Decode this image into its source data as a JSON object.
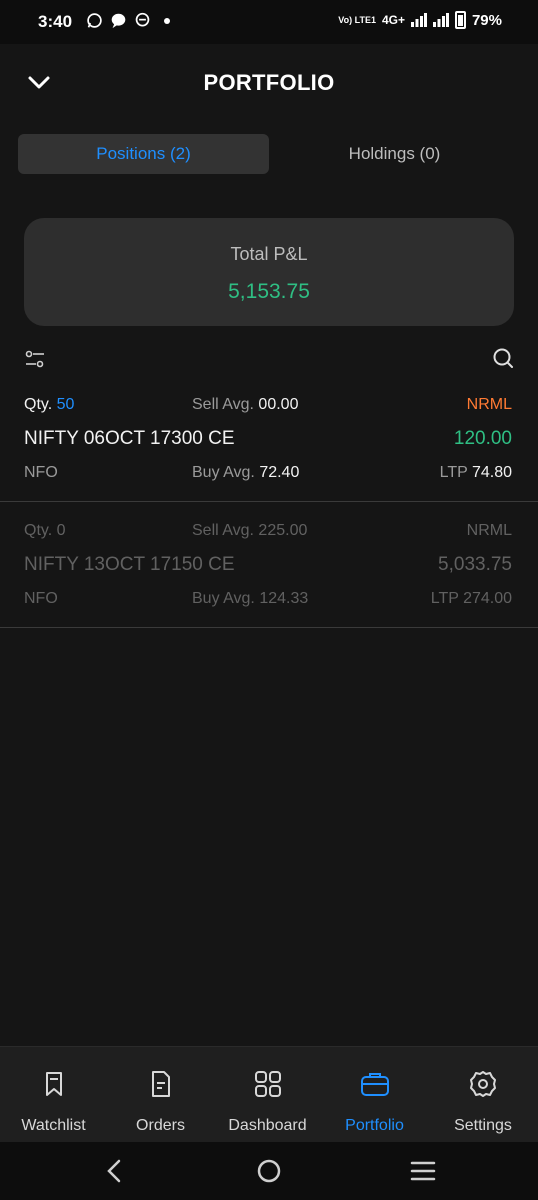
{
  "status_bar": {
    "time": "3:40",
    "network_small": "Vo) LTE1",
    "network": "4G+",
    "battery": "79%"
  },
  "header": {
    "title": "PORTFOLIO"
  },
  "tabs": [
    {
      "label": "Positions (2)",
      "active": true
    },
    {
      "label": "Holdings (0)",
      "active": false
    }
  ],
  "pnl": {
    "label": "Total P&L",
    "value": "5,153.75"
  },
  "positions": [
    {
      "qty_label": "Qty.",
      "qty": "50",
      "sell_avg_label": "Sell Avg.",
      "sell_avg": "00.00",
      "product": "NRML",
      "symbol": "NIFTY 06OCT 17300 CE",
      "pnl": "120.00",
      "exchange": "NFO",
      "buy_avg_label": "Buy Avg.",
      "buy_avg": "72.40",
      "ltp_label": "LTP",
      "ltp": "74.80"
    },
    {
      "qty_label": "Qty.",
      "qty": "0",
      "sell_avg_label": "Sell Avg.",
      "sell_avg": "225.00",
      "product": "NRML",
      "symbol": "NIFTY 13OCT 17150 CE",
      "pnl": "5,033.75",
      "exchange": "NFO",
      "buy_avg_label": "Buy Avg.",
      "buy_avg": "124.33",
      "ltp_label": "LTP",
      "ltp": "274.00"
    }
  ],
  "bottom_nav": [
    {
      "label": "Watchlist",
      "icon": "bookmark-icon"
    },
    {
      "label": "Orders",
      "icon": "document-icon"
    },
    {
      "label": "Dashboard",
      "icon": "grid-icon"
    },
    {
      "label": "Portfolio",
      "icon": "briefcase-icon",
      "active": true
    },
    {
      "label": "Settings",
      "icon": "gear-icon"
    }
  ],
  "colors": {
    "accent": "#1f8fff",
    "profit": "#2fbf84",
    "product": "#ff7a33",
    "background": "#151515"
  }
}
